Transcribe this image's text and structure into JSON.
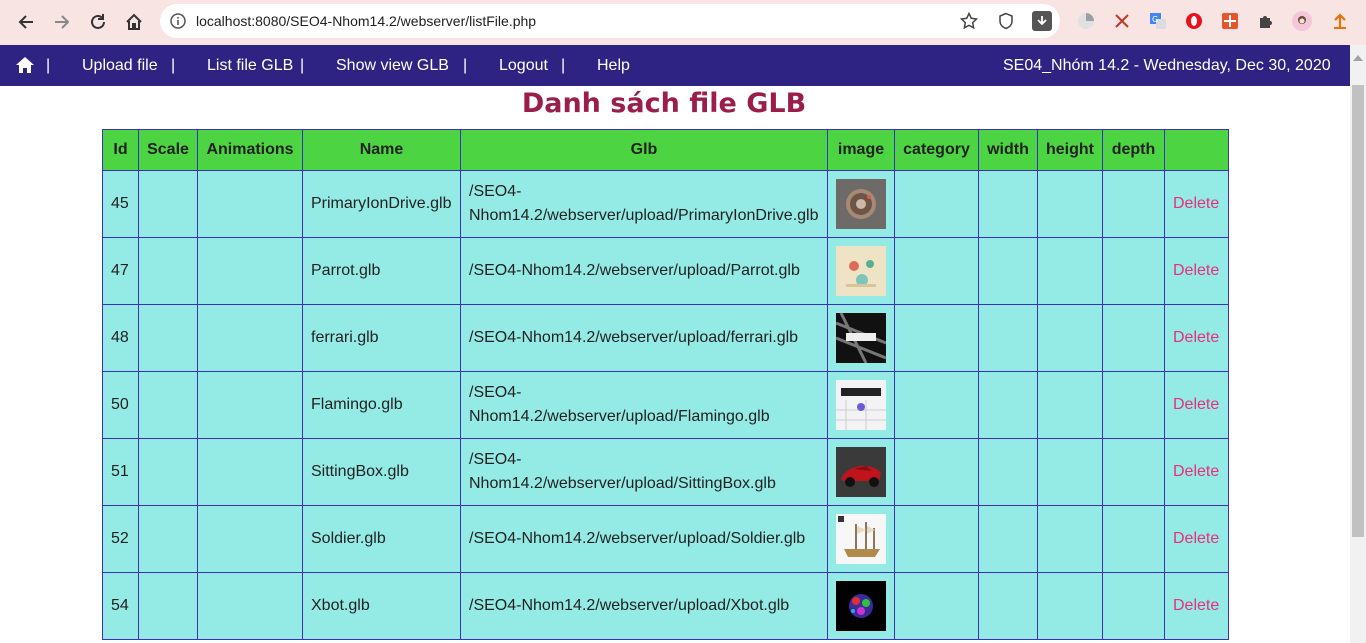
{
  "browser": {
    "url": "localhost:8080/SEO4-Nhom14.2/webserver/listFile.php"
  },
  "nav": {
    "home_icon": "home-icon",
    "items": [
      "Upload file",
      "List file GLB",
      "Show view GLB",
      "Logout",
      "Help"
    ],
    "separator": "|",
    "info": "SE04_Nhóm 14.2 - Wednesday, Dec 30, 2020"
  },
  "page": {
    "title": "Danh sách file GLB"
  },
  "table": {
    "headers": [
      "Id",
      "Scale",
      "Animations",
      "Name",
      "Glb",
      "image",
      "category",
      "width",
      "height",
      "depth",
      ""
    ],
    "rows": [
      {
        "id": "45",
        "name": "PrimaryIonDrive.glb",
        "glb_1": "/SEO4-",
        "glb_2": "Nhom14.2/webserver/upload/PrimaryIonDrive.glb",
        "action": "Delete"
      },
      {
        "id": "47",
        "name": "Parrot.glb",
        "glb_1": "/SEO4-Nhom14.2/webserver/upload/Parrot.glb",
        "glb_2": "",
        "action": "Delete"
      },
      {
        "id": "48",
        "name": "ferrari.glb",
        "glb_1": "/SEO4-Nhom14.2/webserver/upload/ferrari.glb",
        "glb_2": "",
        "action": "Delete"
      },
      {
        "id": "50",
        "name": "Flamingo.glb",
        "glb_1": "/SEO4-",
        "glb_2": "Nhom14.2/webserver/upload/Flamingo.glb",
        "action": "Delete"
      },
      {
        "id": "51",
        "name": "SittingBox.glb",
        "glb_1": "/SEO4-",
        "glb_2": "Nhom14.2/webserver/upload/SittingBox.glb",
        "action": "Delete"
      },
      {
        "id": "52",
        "name": "Soldier.glb",
        "glb_1": "/SEO4-Nhom14.2/webserver/upload/Soldier.glb",
        "glb_2": "",
        "action": "Delete"
      },
      {
        "id": "54",
        "name": "Xbot.glb",
        "glb_1": "/SEO4-Nhom14.2/webserver/upload/Xbot.glb",
        "glb_2": "",
        "action": "Delete"
      }
    ]
  }
}
